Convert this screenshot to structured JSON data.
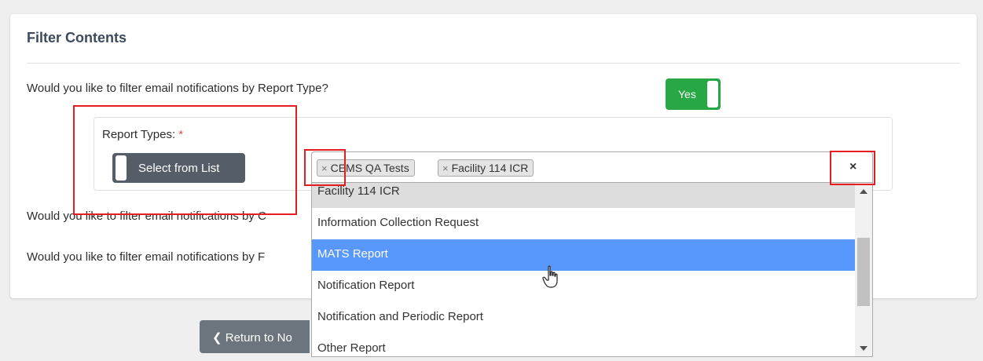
{
  "section": {
    "title": "Filter Contents"
  },
  "questions": {
    "report_type": "Would you like to filter email notifications by Report Type?",
    "second": "Would you like to filter email notifications by C",
    "third": "Would you like to filter email notifications by F"
  },
  "toggle": {
    "label": "Yes",
    "state": "on",
    "color": "#28a745"
  },
  "report_types": {
    "label": "Report Types:",
    "required_mark": "*",
    "select_button": "Select from List",
    "tags": [
      "CEMS QA Tests",
      "Facility 114 ICR"
    ],
    "tag_remove": "×",
    "clear": "×"
  },
  "dropdown": {
    "options": [
      "Facility 114 ICR",
      "Information Collection Request",
      "MATS Report",
      "Notification Report",
      "Notification and Periodic Report",
      "Other Report"
    ],
    "highlighted": "MATS Report",
    "highlight_color": "#5897fb"
  },
  "footer": {
    "return_button": "Return to No",
    "return_icon": "chevron-left-icon"
  },
  "annotation_color": "#e41e1e"
}
